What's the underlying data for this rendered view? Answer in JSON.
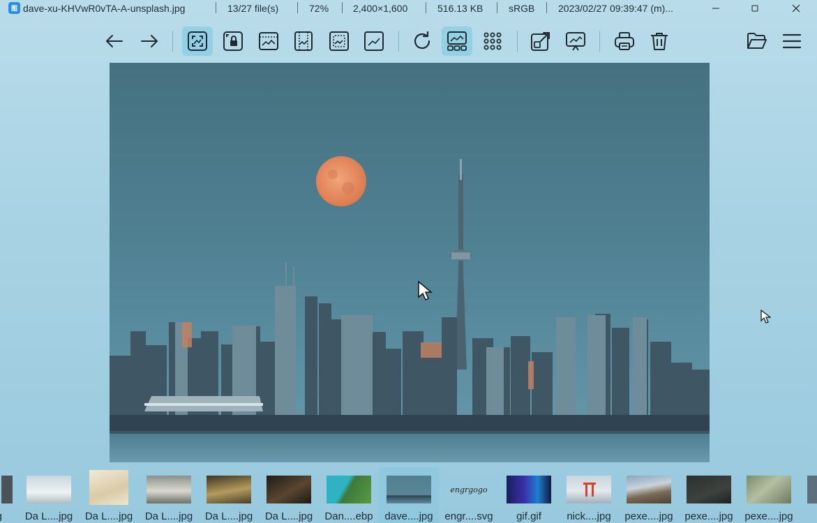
{
  "titlebar": {
    "app_icon_label": "图",
    "filename": "dave-xu-KHVwR0vTA-A-unsplash.jpg",
    "file_index": "13/27 file(s)",
    "zoom": "72%",
    "dimensions": "2,400×1,600",
    "filesize": "516.13 KB",
    "colorspace": "sRGB",
    "datetime": "2023/02/27 09:39:47 (m)..."
  },
  "window_controls": {
    "minimize": "—",
    "maximize": "▢",
    "close": "✕"
  },
  "toolbar": {
    "icons": [
      "arrow-left-icon",
      "arrow-right-icon",
      "auto-zoom-icon",
      "lock-zoom-icon",
      "scale-to-width-icon",
      "scale-to-height-icon",
      "scale-to-fit-icon",
      "scale-to-fill-icon",
      "refresh-icon",
      "thumbnail-bar-icon",
      "gallery-grid-icon",
      "open-with-icon",
      "slideshow-icon",
      "print-icon",
      "delete-icon",
      "open-folder-icon",
      "menu-icon"
    ],
    "active": [
      "auto-zoom-icon",
      "thumbnail-bar-icon"
    ]
  },
  "colors": {
    "accent": "#2a8fe0",
    "active_button": "#7cc8e0",
    "background": "#a9d3e4",
    "sky": "#4f7f94",
    "moon": "#e98b5e"
  },
  "filmstrip": {
    "items": [
      {
        "label": "jpg"
      },
      {
        "label": "Da L....jpg"
      },
      {
        "label": "Da L....jpg"
      },
      {
        "label": "Da L....jpg"
      },
      {
        "label": "Da L....jpg"
      },
      {
        "label": "Da L....jpg"
      },
      {
        "label": "Dan....ebp"
      },
      {
        "label": "dave....jpg"
      },
      {
        "label": "engr....svg"
      },
      {
        "label": "gif.gif"
      },
      {
        "label": "nick....jpg"
      },
      {
        "label": "pexe....jpg"
      },
      {
        "label": "pexe....jpg"
      },
      {
        "label": "pexe....jpg"
      }
    ],
    "active_index": 7,
    "svg_thumb_text": "engrgogo"
  }
}
